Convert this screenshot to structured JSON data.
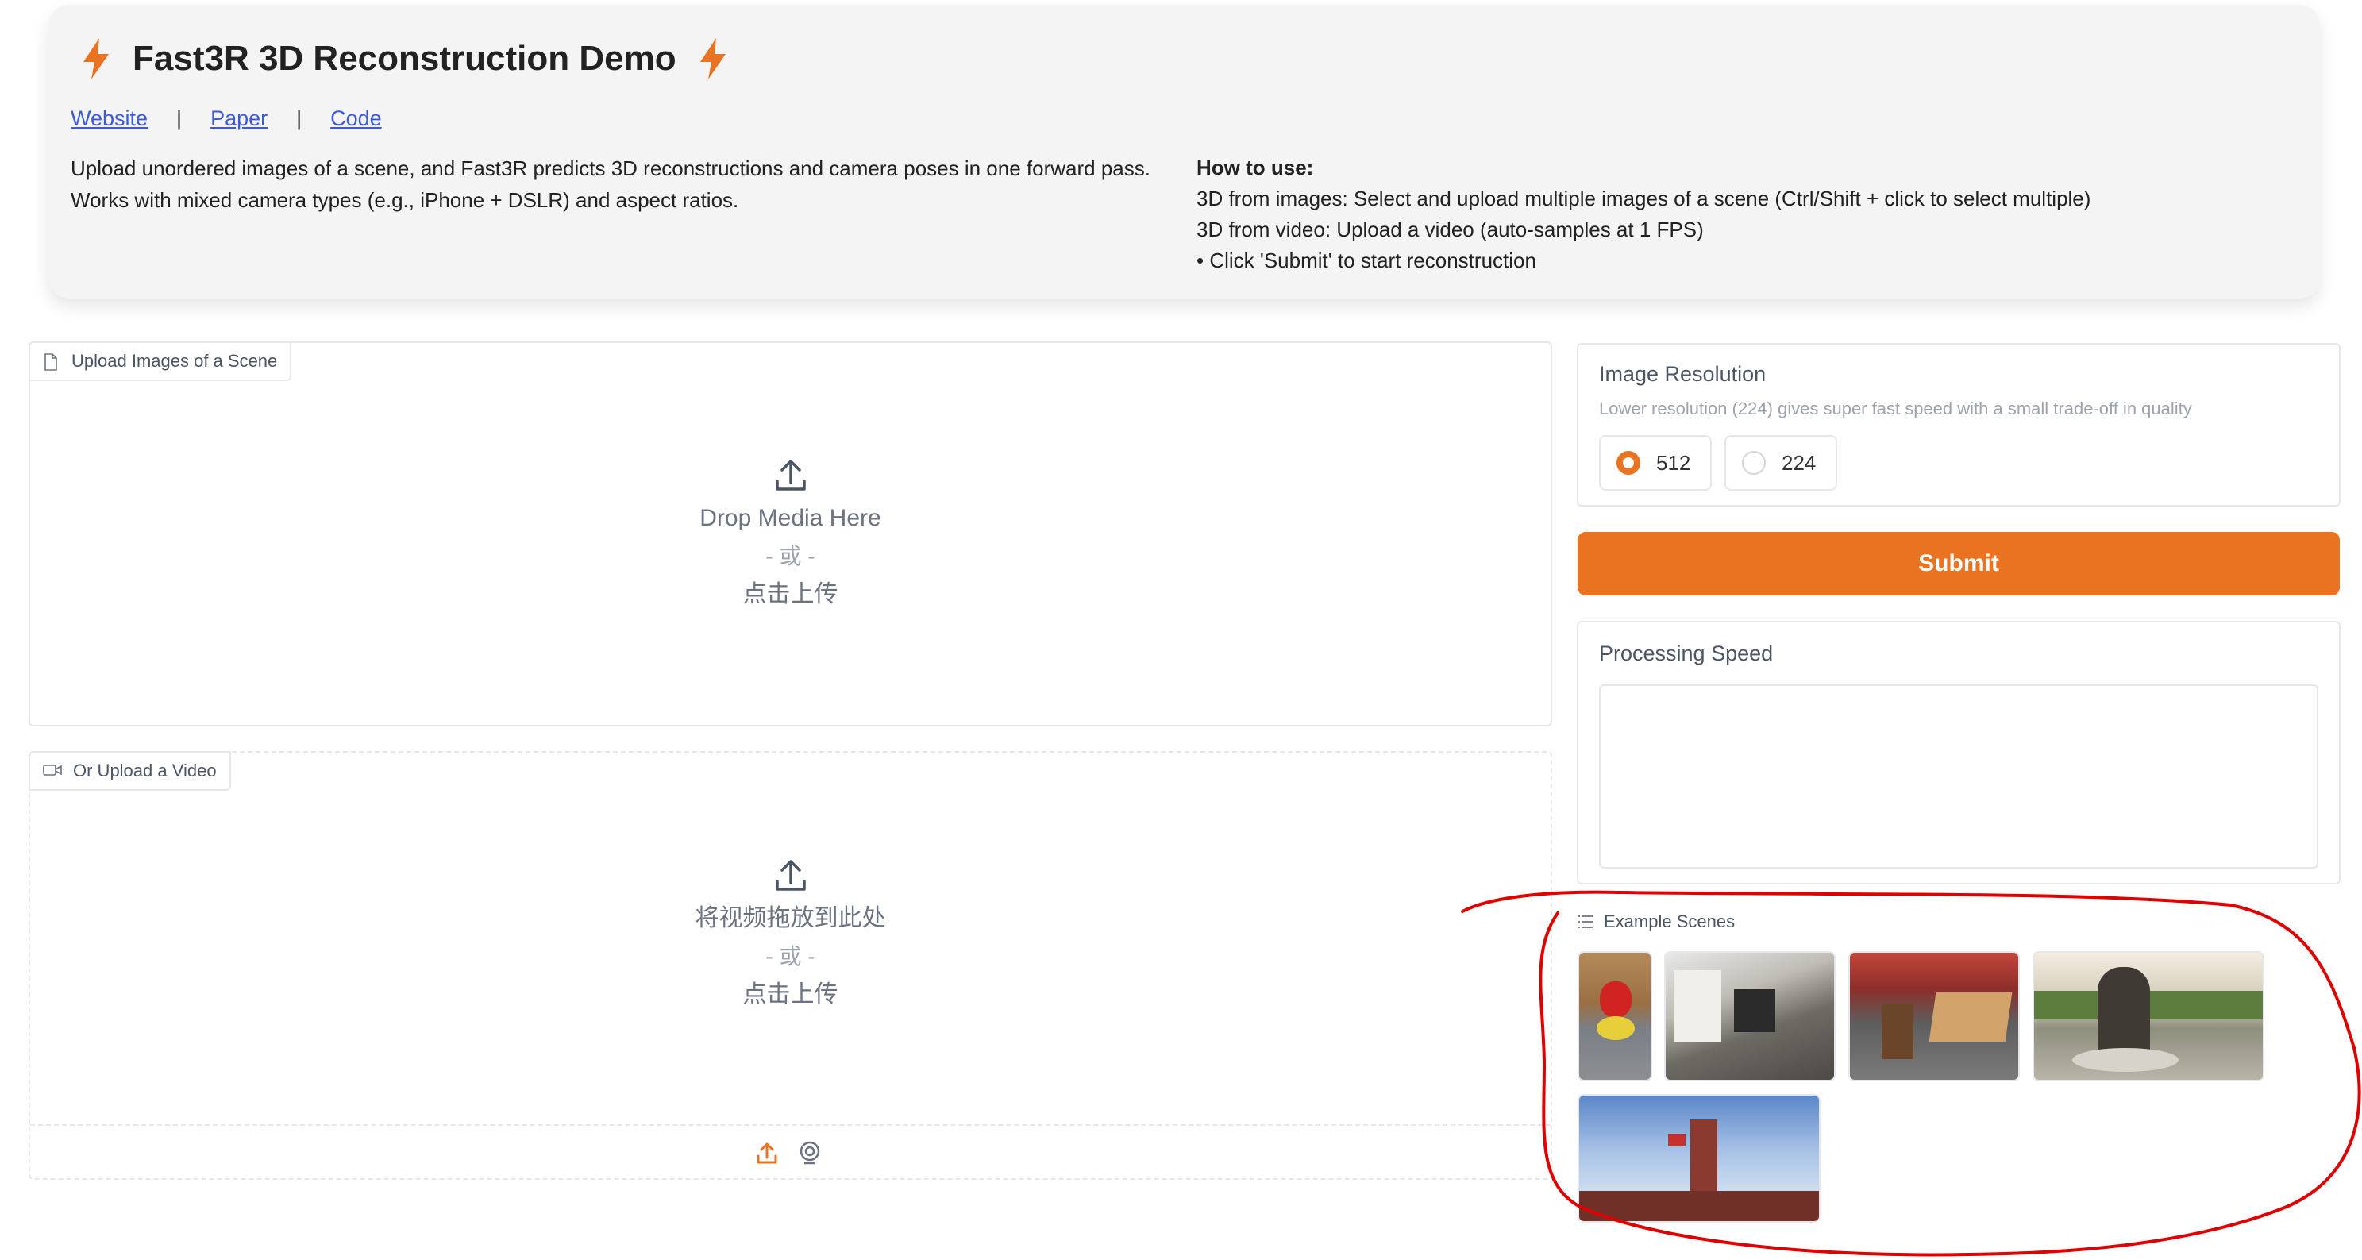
{
  "header": {
    "title": "Fast3R 3D Reconstruction Demo",
    "links": [
      "Website",
      "Paper",
      "Code"
    ],
    "separator": "|",
    "description": [
      "Upload unordered images of a scene, and Fast3R predicts 3D reconstructions and camera poses in one forward pass.",
      "Works with mixed camera types (e.g., iPhone + DSLR) and aspect ratios."
    ],
    "howto": {
      "heading": "How to use:",
      "lines": [
        "3D from images: Select and upload multiple images of a scene (Ctrl/Shift + click to select multiple)",
        "3D from video: Upload a video (auto-samples at 1 FPS)",
        "• Click 'Submit' to start reconstruction"
      ]
    }
  },
  "upload_images": {
    "label": "Upload Images of a Scene",
    "drop_text": "Drop Media Here",
    "or_text": "- 或 -",
    "click_text": "点击上传"
  },
  "upload_video": {
    "label": "Or Upload a Video",
    "drop_text": "将视频拖放到此处",
    "or_text": "- 或 -",
    "click_text": "点击上传"
  },
  "resolution": {
    "label": "Image Resolution",
    "info": "Lower resolution (224) gives super fast speed with a small trade-off in quality",
    "options": [
      "512",
      "224"
    ],
    "selected": "512"
  },
  "submit_label": "Submit",
  "processing": {
    "label": "Processing Speed",
    "value": ""
  },
  "examples": {
    "label": "Example Scenes",
    "items": [
      "teddy-bear-scene",
      "kitchen-scene",
      "dining-room-scene",
      "statue-scene",
      "tower-scene"
    ]
  },
  "colors": {
    "accent": "#ea7321",
    "link": "#3b5bdb",
    "annotation": "#e00000"
  }
}
